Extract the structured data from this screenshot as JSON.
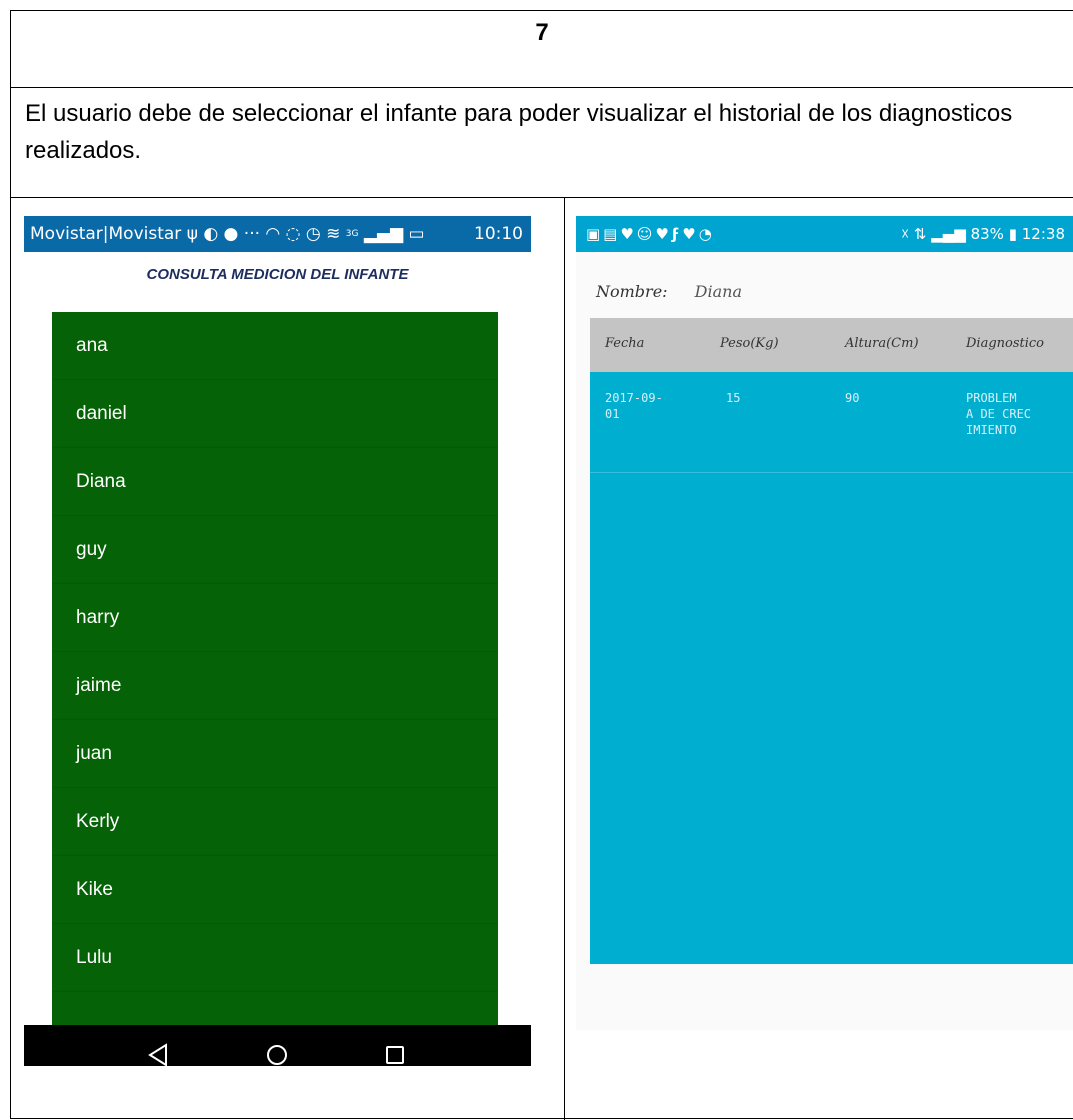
{
  "document": {
    "number": "7",
    "description": "El usuario debe de seleccionar el infante para poder visualizar el historial de los diagnosticos realizados."
  },
  "left_screen": {
    "status_bar": {
      "carrier": "Movistar|Movistar",
      "network": "3G",
      "time": "10:10"
    },
    "title": "CONSULTA MEDICION DEL INFANTE",
    "list_items": [
      "ana",
      "daniel",
      "Diana",
      "guy",
      "harry",
      "jaime",
      "juan",
      "Kerly",
      "Kike",
      "Lulu"
    ],
    "nav_bar": {
      "back_icon": "back-triangle-icon",
      "home_icon": "home-circle-icon",
      "recents_icon": "recents-square-icon"
    }
  },
  "right_screen": {
    "status_bar": {
      "battery": "83%",
      "time": "12:38"
    },
    "name_label": "Nombre:",
    "name_value": "Diana",
    "table": {
      "headers": [
        "Fecha",
        "Peso(Kg)",
        "Altura(Cm)",
        "Diagnostico"
      ],
      "rows": [
        {
          "fecha": "2017-09-\n01",
          "peso": "15",
          "altura": "90",
          "diagnostico": "PROBLEM\nA DE CREC\nIMIENTO"
        }
      ]
    }
  },
  "colors": {
    "list_green": "#066206",
    "table_blue": "#00aed0",
    "header_gray": "#c4c4c4",
    "left_status_blue": "#0a6aa8",
    "right_status_blue": "#00a4d1"
  }
}
